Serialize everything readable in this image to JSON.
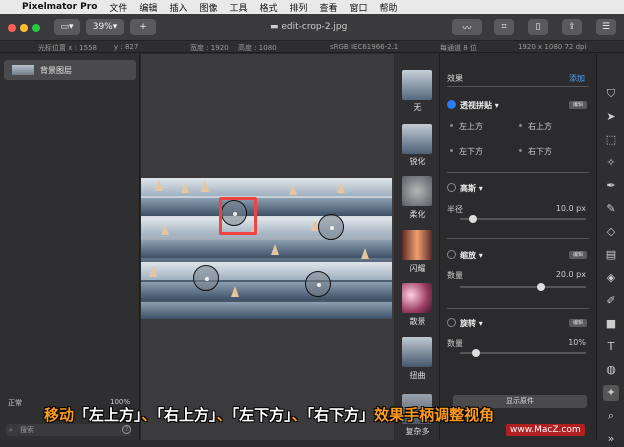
{
  "menubar": {
    "app_name": "Pixelmator Pro",
    "menus": [
      "文件",
      "编辑",
      "插入",
      "图像",
      "工具",
      "格式",
      "排列",
      "查看",
      "窗口",
      "帮助"
    ]
  },
  "toolbar": {
    "zoom": "39%",
    "add_label": "+",
    "document_title": "edit-crop-2.jpg"
  },
  "infobar": {
    "cursor_x_label": "光标位置 x : 1558",
    "cursor_y_label": "y : 827",
    "width_label": "宽度 : 1920",
    "height_label": "高度 : 1080",
    "color_profile": "sRGB IEC61966-2.1",
    "channel_depth": "每通道 8 位",
    "size_info": "1920 x 1080 72 dpi"
  },
  "layers": {
    "items": [
      {
        "label": "背景图层"
      }
    ]
  },
  "status": {
    "blend_mode": "正常",
    "opacity": "100%",
    "search_placeholder": "搜索"
  },
  "effects_browser": {
    "items": [
      {
        "label": "无"
      },
      {
        "label": "锐化"
      },
      {
        "label": "柔化"
      },
      {
        "label": "闪耀"
      },
      {
        "label": "散景"
      },
      {
        "label": "扭曲"
      },
      {
        "label": "复杂多"
      }
    ]
  },
  "properties": {
    "header": "效果",
    "add_label": "添加",
    "edit_label": "编辑",
    "perspective": {
      "name": "透视拼贴",
      "top_left": "左上方",
      "top_right": "右上方",
      "bottom_left": "左下方",
      "bottom_right": "右下方"
    },
    "gaussian": {
      "name": "高斯",
      "radius_label": "半径",
      "radius_value": "10.0 px",
      "radius_fraction": 0.08
    },
    "zoom_effect": {
      "name": "缩放",
      "amount_label": "数量",
      "amount_value": "20.0 px",
      "amount_fraction": 0.65
    },
    "twirl": {
      "name": "旋转",
      "amount_label": "数量",
      "amount_value": "10%",
      "amount_fraction": 0.1
    },
    "show_original": "显示原件"
  },
  "caption": {
    "part1": "移动",
    "tl": "「左上方」",
    "sep1": "、",
    "tr": "「右上方」",
    "sep2": "、",
    "bl": "「左下方」",
    "sep3": "、",
    "br": "「右下方」",
    "part2": "效果手柄调整视角"
  },
  "watermark": "www.MacZ.com",
  "colors": {
    "accent": "#2a7bf5",
    "caption": "#ff9a1a",
    "highlight": "#e44444"
  }
}
